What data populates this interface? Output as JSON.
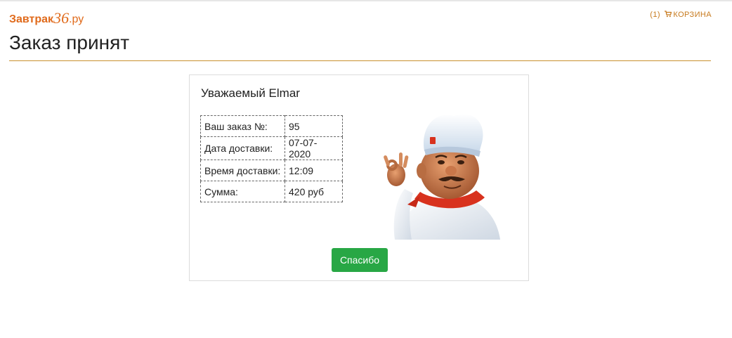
{
  "header": {
    "logo_prefix": "Завтрак",
    "logo_number": "36",
    "logo_suffix": ".ру",
    "cart_count": "(1)",
    "cart_label": "КОРЗИНА"
  },
  "page": {
    "title": "Заказ принят"
  },
  "card": {
    "greeting": "Уважаемый Elmar",
    "rows": [
      {
        "label": "Ваш заказ №:",
        "value": "95"
      },
      {
        "label": "Дата доставки:",
        "value": "07-07-2020"
      },
      {
        "label": "Время доставки:",
        "value": "12:09"
      },
      {
        "label": "Сумма:",
        "value": "420 руб"
      }
    ],
    "thanks_button": "Спасибо"
  },
  "colors": {
    "brand": "#e06a1b",
    "cart": "#c77a1e",
    "rule": "#c9902d",
    "button": "#28a745"
  },
  "icons": {
    "cart": "cart-icon",
    "chef": "chef-illustration"
  }
}
